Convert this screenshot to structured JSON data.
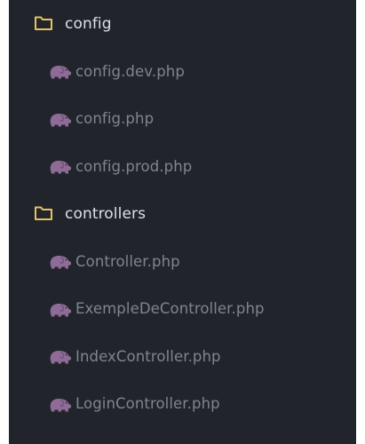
{
  "explorer": {
    "items": [
      {
        "kind": "folder",
        "icon": "folder-icon",
        "label": "config"
      },
      {
        "kind": "file",
        "icon": "php-elephant-icon",
        "label": "config.dev.php"
      },
      {
        "kind": "file",
        "icon": "php-elephant-icon",
        "label": "config.php"
      },
      {
        "kind": "file",
        "icon": "php-elephant-icon",
        "label": "config.prod.php"
      },
      {
        "kind": "folder",
        "icon": "folder-icon",
        "label": "controllers"
      },
      {
        "kind": "file",
        "icon": "php-elephant-icon",
        "label": "Controller.php"
      },
      {
        "kind": "file",
        "icon": "php-elephant-icon",
        "label": "ExempleDeController.php"
      },
      {
        "kind": "file",
        "icon": "php-elephant-icon",
        "label": "IndexController.php"
      },
      {
        "kind": "file",
        "icon": "php-elephant-icon",
        "label": "LoginController.php"
      }
    ]
  },
  "colors": {
    "panel_background": "#21252b",
    "folder_icon": "#e8c15f",
    "php_icon": "#8f6b97",
    "folder_text": "#dbe0e7",
    "file_text": "#7e8591"
  }
}
